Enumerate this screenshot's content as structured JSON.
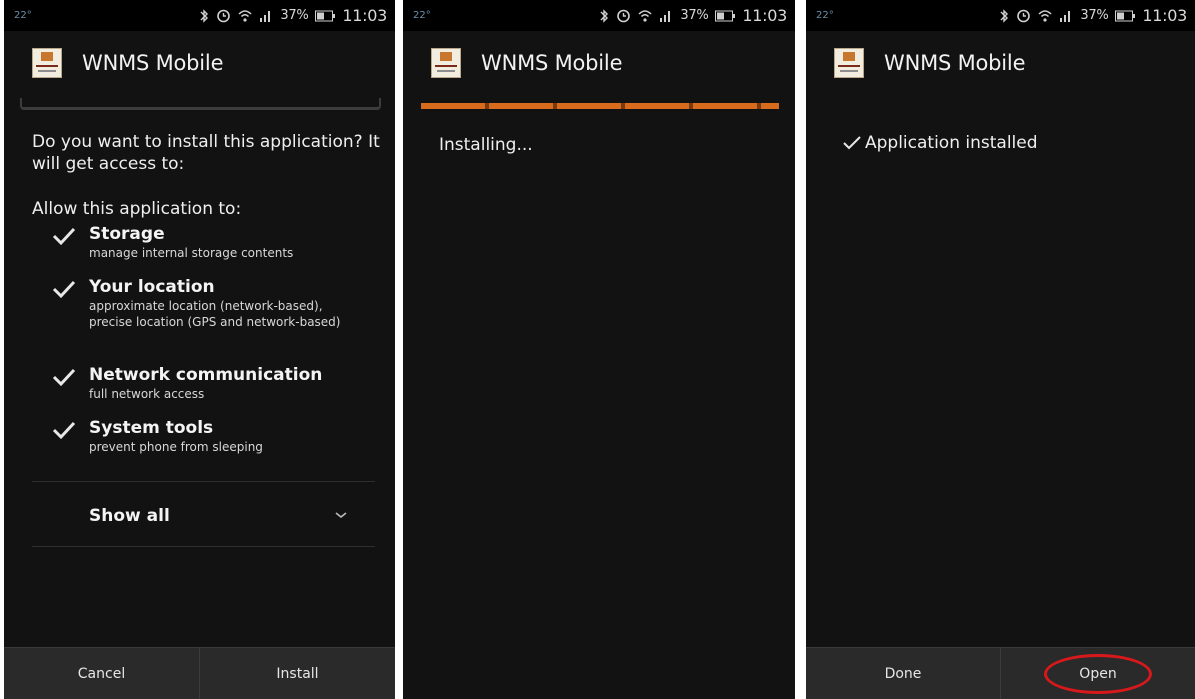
{
  "statusbar": {
    "temperature": "22°",
    "battery_percent": "37%",
    "time": "11:03"
  },
  "app": {
    "title": "WNMS Mobile"
  },
  "permissions_screen": {
    "question": "Do you want to install this application? It will get access to:",
    "allow_label": "Allow this application to:",
    "permissions": [
      {
        "title": "Storage",
        "description": "manage internal storage contents"
      },
      {
        "title": "Your location",
        "description": "approximate location (network-based), precise location (GPS and network-based)"
      },
      {
        "title": "Network communication",
        "description": "full network access"
      },
      {
        "title": "System tools",
        "description": "prevent phone from sleeping"
      }
    ],
    "show_all_label": "Show all",
    "cancel_label": "Cancel",
    "install_label": "Install"
  },
  "installing_screen": {
    "status_text": "Installing...",
    "progress_percent": 100
  },
  "installed_screen": {
    "status_text": "Application installed",
    "done_label": "Done",
    "open_label": "Open",
    "highlight_color": "#d8191c"
  },
  "colors": {
    "background": "#121212",
    "accent": "#d96c1c"
  },
  "icons": {
    "status": [
      "bluetooth-icon",
      "alarm-icon",
      "wifi-icon",
      "signal-icon",
      "battery-icon"
    ],
    "check": "checkmark-icon",
    "chevron": "chevron-down-icon"
  }
}
